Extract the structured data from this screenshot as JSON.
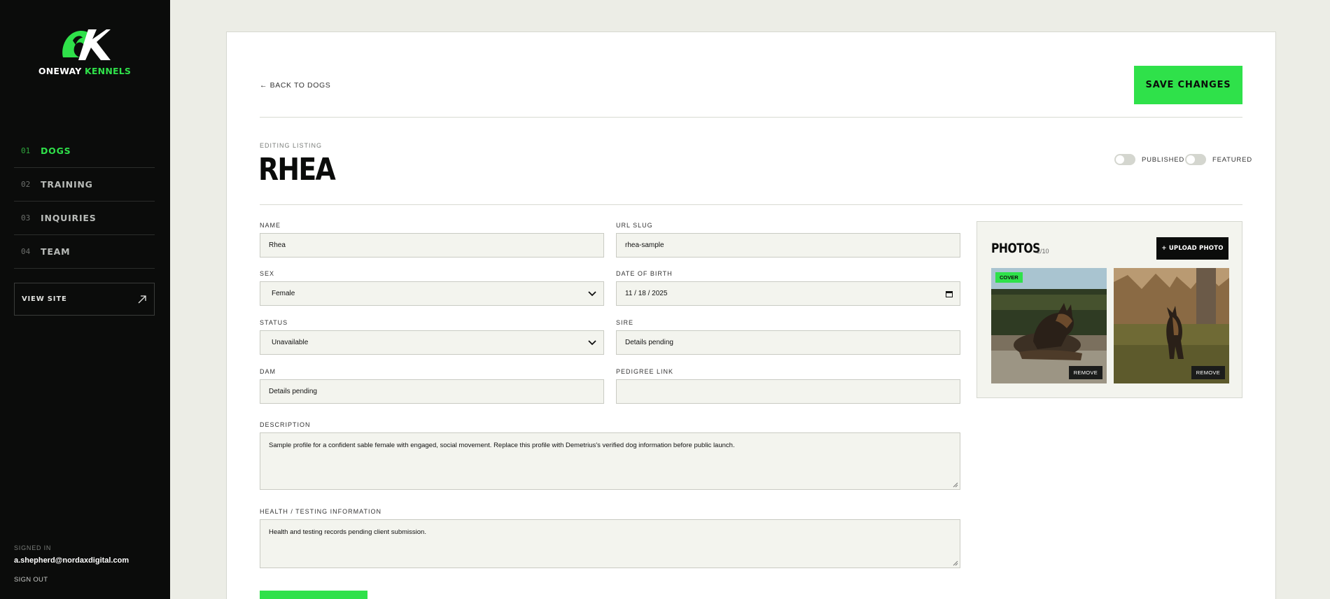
{
  "brand": {
    "name_part1": "ONEWAY",
    "name_part2": "KENNELS",
    "accent": "#2fe14a",
    "sidebar_bg": "#0b0c0b"
  },
  "sidebar": {
    "nav": [
      {
        "num": "01",
        "label": "DOGS",
        "active": true
      },
      {
        "num": "02",
        "label": "TRAINING",
        "active": false
      },
      {
        "num": "03",
        "label": "INQUIRIES",
        "active": false
      },
      {
        "num": "04",
        "label": "TEAM",
        "active": false
      }
    ],
    "view_site": "VIEW SITE",
    "signed_in_label": "SIGNED IN",
    "email": "a.shepherd@nordaxdigital.com",
    "sign_out": "SIGN OUT"
  },
  "header": {
    "back": "← BACK TO DOGS",
    "save": "SAVE CHANGES"
  },
  "listing": {
    "editing_label": "EDITING LISTING",
    "title": "RHEA"
  },
  "toggles": {
    "published": "PUBLISHED",
    "featured": "FEATURED",
    "published_on": false,
    "featured_on": false
  },
  "form": {
    "name": {
      "label": "NAME",
      "value": "Rhea"
    },
    "url_slug": {
      "label": "URL SLUG",
      "value": "rhea-sample"
    },
    "sex": {
      "label": "SEX",
      "value": "Female"
    },
    "dob": {
      "label": "DATE OF BIRTH",
      "value": "11 / 18 / 2025"
    },
    "status": {
      "label": "STATUS",
      "value": "Unavailable"
    },
    "sire": {
      "label": "SIRE",
      "value": "Details pending"
    },
    "dam": {
      "label": "DAM",
      "value": "Details pending"
    },
    "pedigree": {
      "label": "PEDIGREE LINK",
      "value": ""
    },
    "description": {
      "label": "DESCRIPTION",
      "value": "Sample profile for a confident sable female with engaged, social movement. Replace this profile with Demetrius's verified dog information before public launch."
    },
    "health": {
      "label": "HEALTH / TESTING INFORMATION",
      "value": "Health and testing records pending client submission."
    }
  },
  "photos": {
    "title": "PHOTOS",
    "count": "2/10",
    "upload": "+ UPLOAD PHOTO",
    "cover_badge": "COVER",
    "remove": "REMOVE"
  }
}
